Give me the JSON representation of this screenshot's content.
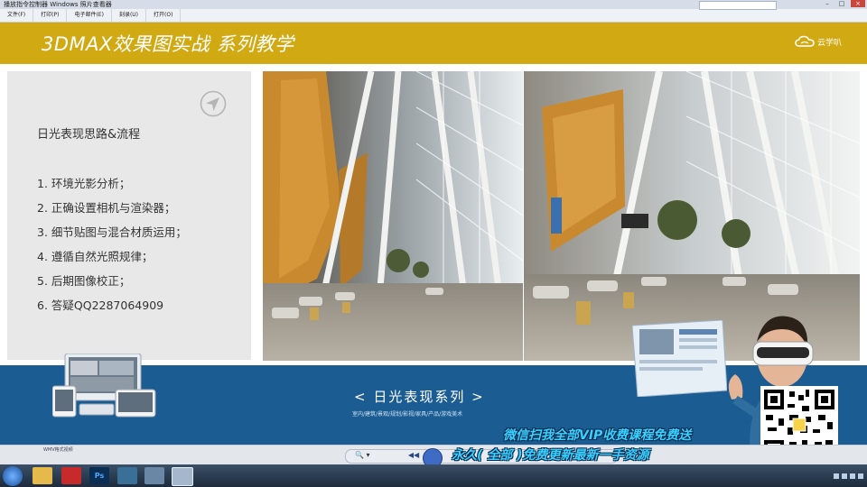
{
  "window": {
    "title": "播放指令控制器  Windows 照片查看器",
    "buttons": [
      "–",
      "□",
      "×"
    ]
  },
  "menubar": {
    "items": [
      "文件(F)",
      "打印(P)",
      "电子邮件(E)",
      "刻录(U)",
      "打开(O)"
    ]
  },
  "slide": {
    "title": "3DMAX效果图实战  系列教学",
    "logo_text": "云学叭"
  },
  "left_panel": {
    "heading": "日光表现思路&流程",
    "steps": [
      "1.  环境光影分析；",
      "2.  正确设置相机与渲染器；",
      "3.  细节贴图与混合材质运用；",
      "4.  遵循自然光照规律；",
      "5.  后期图像校正；",
      "6.  答疑QQ2287064909"
    ]
  },
  "banner": {
    "title": "<  日光表现系列  >",
    "subtitle": "室内/建筑/景观/规划/影视/家具/产品/游戏美术",
    "promo_line1": "微信扫我全部VIP收费课程免费送",
    "promo_line2": "永久( 全部 )免费更新最新一手资源"
  },
  "player": {
    "small_label": "WMV格式视频",
    "zoom": "🔍 ▾",
    "prev": "◀◀",
    "play": "▶"
  },
  "taskbar": {
    "ps_label": "Ps"
  },
  "colors": {
    "header_gold": "#d1aa13",
    "banner_blue": "#1b5c93",
    "panel_gray": "#e8e8e8",
    "promo_cyan": "#3bd0ff"
  }
}
